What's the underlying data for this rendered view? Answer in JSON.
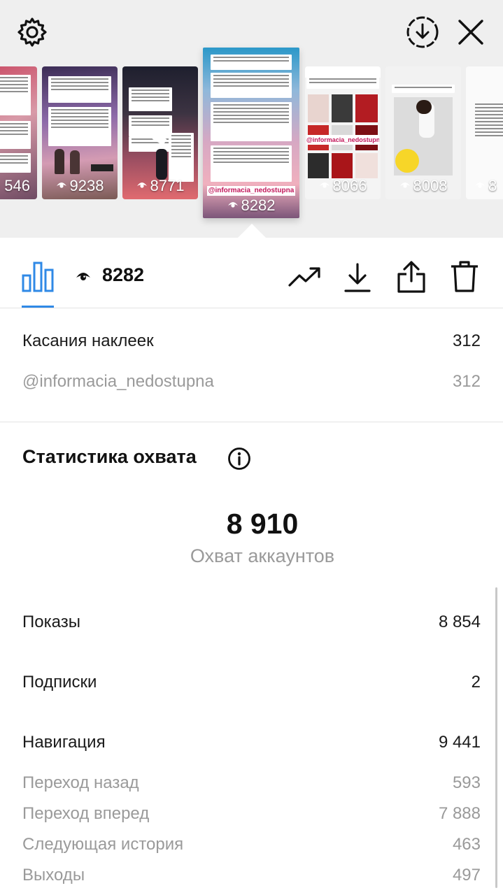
{
  "stories": [
    {
      "views": "546"
    },
    {
      "views": "9238"
    },
    {
      "views": "8771"
    },
    {
      "views": "8282",
      "selected": true,
      "handle": "@informacia_nedostupna"
    },
    {
      "views": "8066",
      "handle": "@informacia_nedostupna"
    },
    {
      "views": "8008"
    },
    {
      "views": "8"
    }
  ],
  "toolbar": {
    "view_count": "8282"
  },
  "sticker_taps": {
    "label": "Касания наклеек",
    "value": "312",
    "sub_label": "@informacia_nedostupna",
    "sub_value": "312"
  },
  "reach": {
    "title": "Статистика охвата",
    "accounts_reached": "8 910",
    "accounts_reached_label": "Охват аккаунтов",
    "impressions_label": "Показы",
    "impressions_value": "8 854",
    "follows_label": "Подписки",
    "follows_value": "2",
    "navigation_label": "Навигация",
    "navigation_value": "9 441",
    "back_label": "Переход назад",
    "back_value": "593",
    "forward_label": "Переход вперед",
    "forward_value": "7 888",
    "next_story_label": "Следующая история",
    "next_story_value": "463",
    "exits_label": "Выходы",
    "exits_value": "497"
  },
  "colors": {
    "accent": "#2f89e6",
    "muted_text": "#9a9a9a",
    "top_background": "#efefef"
  },
  "icons": [
    "settings-gear-icon",
    "download-circle-icon",
    "close-icon",
    "bar-chart-icon",
    "eye-icon",
    "trending-icon",
    "download-icon",
    "share-icon",
    "trash-icon",
    "info-icon"
  ]
}
